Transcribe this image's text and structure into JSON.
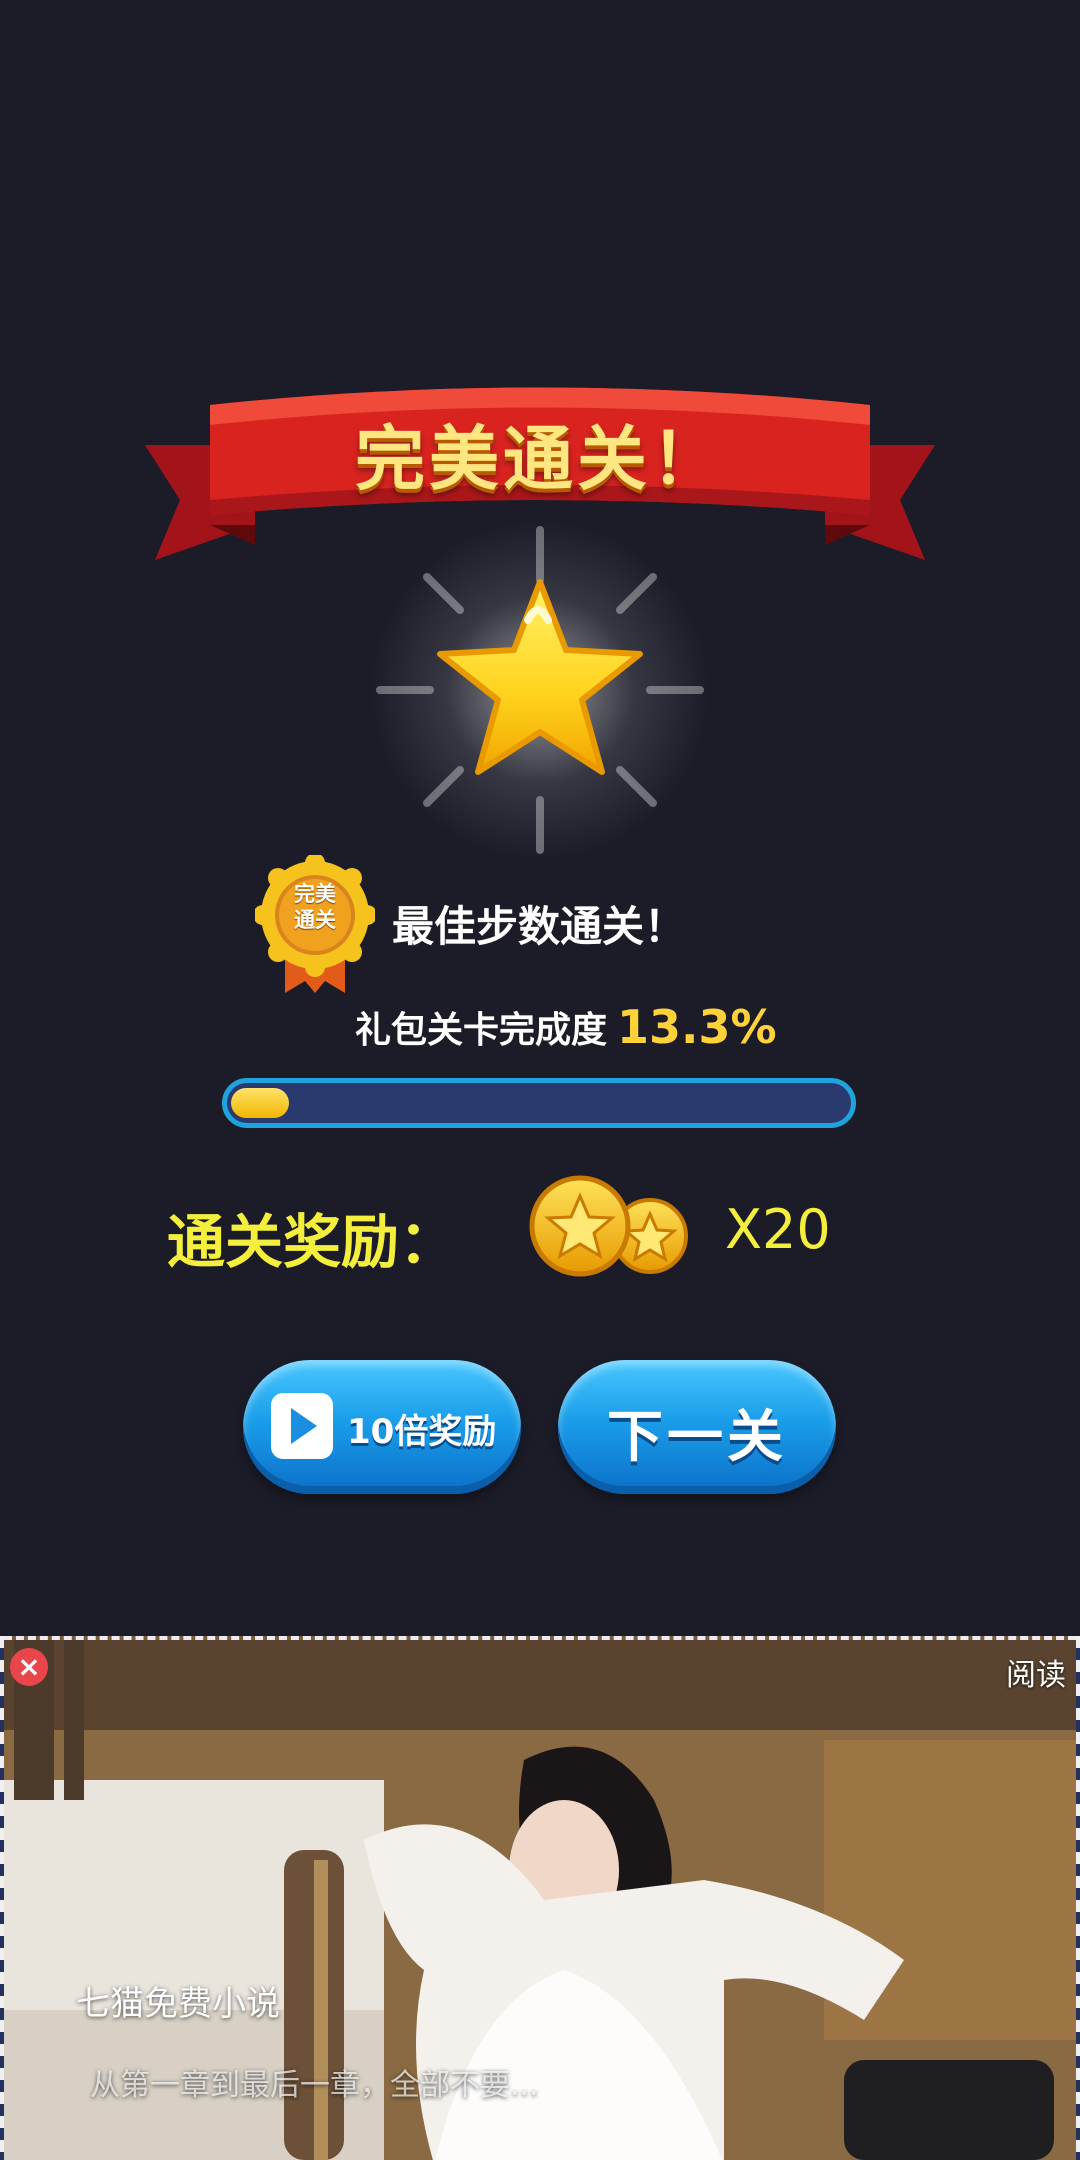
{
  "banner": {
    "title": "完美通关！"
  },
  "badge": {
    "line1": "完美",
    "line2": "通关"
  },
  "best_steps_text": "最佳步数通关！",
  "completion": {
    "label": "礼包关卡完成度",
    "value_text": "13.3%",
    "fraction": 0.133
  },
  "reward": {
    "label": "通关奖励：",
    "count_text": "X20",
    "icon": "gold-coins-icon"
  },
  "buttons": {
    "reward_label": "10倍奖励",
    "next_label": "下一关"
  },
  "ad": {
    "read_label": "阅读",
    "brand": "七猫免费小说",
    "description": "从第一章到最后一章，全部不要..."
  },
  "colors": {
    "background": "#1c1c29",
    "ribbon": "#d8231f",
    "accent_yellow": "#f4ef3c",
    "button_blue": "#1a9ee9",
    "progress_track": "#2b3a6e",
    "progress_border": "#1fa3dc"
  }
}
